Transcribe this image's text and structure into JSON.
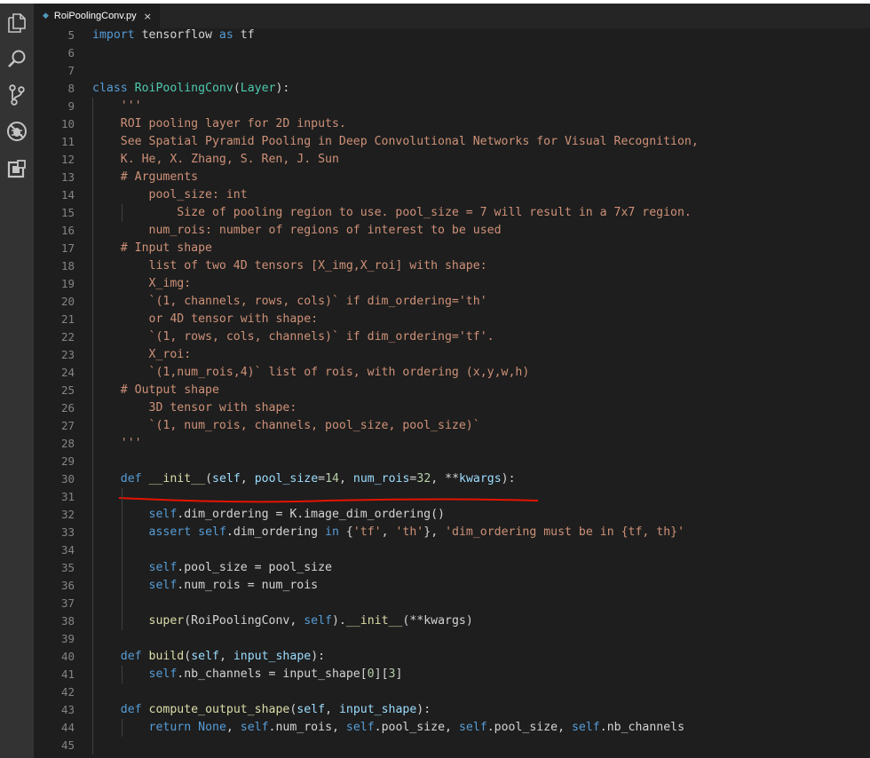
{
  "app": {
    "title": "RoiPoolingConv.py"
  },
  "activity_bar": {
    "icons": [
      "explorer-icon",
      "search-icon",
      "source-control-icon",
      "debug-icon",
      "extensions-icon"
    ]
  },
  "tab": {
    "label": "RoiPoolingConv.py",
    "close": "×",
    "icon": "python-file-icon"
  },
  "colors": {
    "keyword": "#569cd6",
    "function": "#dcdcaa",
    "class": "#4ec9b0",
    "string": "#ce9178",
    "variable": "#9cdcfe",
    "number": "#b5cea8",
    "plain": "#d4d4d4",
    "annotation": "#e51400"
  },
  "lines": [
    {
      "n": "5",
      "t": [
        [
          "kw",
          "import"
        ],
        [
          "p",
          " tensorflow "
        ],
        [
          "kw",
          "as"
        ],
        [
          "p",
          " tf"
        ]
      ]
    },
    {
      "n": "6",
      "t": []
    },
    {
      "n": "7",
      "t": []
    },
    {
      "n": "8",
      "t": [
        [
          "kw",
          "class"
        ],
        [
          "p",
          " "
        ],
        [
          "cls",
          "RoiPoolingConv"
        ],
        [
          "p",
          "("
        ],
        [
          "cls",
          "Layer"
        ],
        [
          "p",
          "):"
        ]
      ]
    },
    {
      "n": "9",
      "t": [
        [
          "p",
          "    "
        ],
        [
          "str",
          "'''"
        ]
      ]
    },
    {
      "n": "10",
      "t": [
        [
          "p",
          "    "
        ],
        [
          "str",
          "ROI pooling layer for 2D inputs."
        ]
      ]
    },
    {
      "n": "11",
      "t": [
        [
          "p",
          "    "
        ],
        [
          "str",
          "See Spatial Pyramid Pooling in Deep Convolutional Networks for Visual Recognition,"
        ]
      ]
    },
    {
      "n": "12",
      "t": [
        [
          "p",
          "    "
        ],
        [
          "str",
          "K. He, X. Zhang, S. Ren, J. Sun"
        ]
      ]
    },
    {
      "n": "13",
      "t": [
        [
          "p",
          "    "
        ],
        [
          "str",
          "# Arguments"
        ]
      ]
    },
    {
      "n": "14",
      "t": [
        [
          "p",
          "        "
        ],
        [
          "str",
          "pool_size: int"
        ]
      ]
    },
    {
      "n": "15",
      "t": [
        [
          "p",
          "            "
        ],
        [
          "str",
          "Size of pooling region to use. pool_size = 7 will result in a 7x7 region."
        ]
      ]
    },
    {
      "n": "16",
      "t": [
        [
          "p",
          "        "
        ],
        [
          "str",
          "num_rois: number of regions of interest to be used"
        ]
      ]
    },
    {
      "n": "17",
      "t": [
        [
          "p",
          "    "
        ],
        [
          "str",
          "# Input shape"
        ]
      ]
    },
    {
      "n": "18",
      "t": [
        [
          "p",
          "        "
        ],
        [
          "str",
          "list of two 4D tensors [X_img,X_roi] with shape:"
        ]
      ]
    },
    {
      "n": "19",
      "t": [
        [
          "p",
          "        "
        ],
        [
          "str",
          "X_img:"
        ]
      ]
    },
    {
      "n": "20",
      "t": [
        [
          "p",
          "        "
        ],
        [
          "str",
          "`(1, channels, rows, cols)` if dim_ordering='th'"
        ]
      ]
    },
    {
      "n": "21",
      "t": [
        [
          "p",
          "        "
        ],
        [
          "str",
          "or 4D tensor with shape:"
        ]
      ]
    },
    {
      "n": "22",
      "t": [
        [
          "p",
          "        "
        ],
        [
          "str",
          "`(1, rows, cols, channels)` if dim_ordering='tf'."
        ]
      ]
    },
    {
      "n": "23",
      "t": [
        [
          "p",
          "        "
        ],
        [
          "str",
          "X_roi:"
        ]
      ]
    },
    {
      "n": "24",
      "t": [
        [
          "p",
          "        "
        ],
        [
          "str",
          "`(1,num_rois,4)` list of rois, with ordering (x,y,w,h)"
        ]
      ]
    },
    {
      "n": "25",
      "t": [
        [
          "p",
          "    "
        ],
        [
          "str",
          "# Output shape"
        ]
      ]
    },
    {
      "n": "26",
      "t": [
        [
          "p",
          "        "
        ],
        [
          "str",
          "3D tensor with shape:"
        ]
      ]
    },
    {
      "n": "27",
      "t": [
        [
          "p",
          "        "
        ],
        [
          "str",
          "`(1, num_rois, channels, pool_size, pool_size)`"
        ]
      ]
    },
    {
      "n": "28",
      "t": [
        [
          "p",
          "    "
        ],
        [
          "str",
          "'''"
        ]
      ]
    },
    {
      "n": "29",
      "t": []
    },
    {
      "n": "30",
      "t": [
        [
          "p",
          "    "
        ],
        [
          "kw",
          "def"
        ],
        [
          "p",
          " "
        ],
        [
          "fn",
          "__init__"
        ],
        [
          "p",
          "("
        ],
        [
          "var",
          "self"
        ],
        [
          "p",
          ", "
        ],
        [
          "var",
          "pool_size"
        ],
        [
          "p",
          "="
        ],
        [
          "num",
          "14"
        ],
        [
          "p",
          ", "
        ],
        [
          "var",
          "num_rois"
        ],
        [
          "p",
          "="
        ],
        [
          "num",
          "32"
        ],
        [
          "p",
          ", **"
        ],
        [
          "var",
          "kwargs"
        ],
        [
          "p",
          "):"
        ]
      ]
    },
    {
      "n": "31",
      "t": []
    },
    {
      "n": "32",
      "t": [
        [
          "p",
          "        "
        ],
        [
          "self",
          "self"
        ],
        [
          "p",
          ".dim_ordering = K.image_dim_ordering()"
        ]
      ]
    },
    {
      "n": "33",
      "t": [
        [
          "p",
          "        "
        ],
        [
          "kw",
          "assert"
        ],
        [
          "p",
          " "
        ],
        [
          "self",
          "self"
        ],
        [
          "p",
          ".dim_ordering "
        ],
        [
          "kw",
          "in"
        ],
        [
          "p",
          " {"
        ],
        [
          "str",
          "'tf'"
        ],
        [
          "p",
          ", "
        ],
        [
          "str",
          "'th'"
        ],
        [
          "p",
          "}, "
        ],
        [
          "str",
          "'dim_ordering must be in {tf, th}'"
        ]
      ]
    },
    {
      "n": "34",
      "t": []
    },
    {
      "n": "35",
      "t": [
        [
          "p",
          "        "
        ],
        [
          "self",
          "self"
        ],
        [
          "p",
          ".pool_size = pool_size"
        ]
      ]
    },
    {
      "n": "36",
      "t": [
        [
          "p",
          "        "
        ],
        [
          "self",
          "self"
        ],
        [
          "p",
          ".num_rois = num_rois"
        ]
      ]
    },
    {
      "n": "37",
      "t": []
    },
    {
      "n": "38",
      "t": [
        [
          "p",
          "        "
        ],
        [
          "fn",
          "super"
        ],
        [
          "p",
          "(RoiPoolingConv, "
        ],
        [
          "self",
          "self"
        ],
        [
          "p",
          ")."
        ],
        [
          "fn",
          "__init__"
        ],
        [
          "p",
          "(**kwargs)"
        ]
      ]
    },
    {
      "n": "39",
      "t": []
    },
    {
      "n": "40",
      "t": [
        [
          "p",
          "    "
        ],
        [
          "kw",
          "def"
        ],
        [
          "p",
          " "
        ],
        [
          "fn",
          "build"
        ],
        [
          "p",
          "("
        ],
        [
          "var",
          "self"
        ],
        [
          "p",
          ", "
        ],
        [
          "var",
          "input_shape"
        ],
        [
          "p",
          "):"
        ]
      ]
    },
    {
      "n": "41",
      "t": [
        [
          "p",
          "        "
        ],
        [
          "self",
          "self"
        ],
        [
          "p",
          ".nb_channels = input_shape["
        ],
        [
          "num",
          "0"
        ],
        [
          "p",
          "]["
        ],
        [
          "num",
          "3"
        ],
        [
          "p",
          "]"
        ]
      ]
    },
    {
      "n": "42",
      "t": []
    },
    {
      "n": "43",
      "t": [
        [
          "p",
          "    "
        ],
        [
          "kw",
          "def"
        ],
        [
          "p",
          " "
        ],
        [
          "fn",
          "compute_output_shape"
        ],
        [
          "p",
          "("
        ],
        [
          "var",
          "self"
        ],
        [
          "p",
          ", "
        ],
        [
          "var",
          "input_shape"
        ],
        [
          "p",
          "):"
        ]
      ]
    },
    {
      "n": "44",
      "t": [
        [
          "p",
          "        "
        ],
        [
          "kw",
          "return"
        ],
        [
          "p",
          " "
        ],
        [
          "kw",
          "None"
        ],
        [
          "p",
          ", "
        ],
        [
          "self",
          "self"
        ],
        [
          "p",
          ".num_rois, "
        ],
        [
          "self",
          "self"
        ],
        [
          "p",
          ".pool_size, "
        ],
        [
          "self",
          "self"
        ],
        [
          "p",
          ".pool_size, "
        ],
        [
          "self",
          "self"
        ],
        [
          "p",
          ".nb_channels"
        ]
      ]
    },
    {
      "n": "45",
      "t": []
    }
  ],
  "guides": {
    "10": 1,
    "11": 1,
    "12": 1,
    "13": 1,
    "14": 1,
    "15": 2,
    "16": 1,
    "17": 1,
    "18": 1,
    "19": 1,
    "20": 1,
    "21": 1,
    "22": 1,
    "23": 1,
    "24": 1,
    "25": 1,
    "26": 1,
    "27": 1,
    "28": 1,
    "29": 1,
    "30": 1,
    "31": 2,
    "32": 2,
    "33": 2,
    "34": 2,
    "35": 2,
    "36": 2,
    "37": 2,
    "38": 2,
    "39": 1,
    "40": 1,
    "41": 2,
    "42": 1,
    "43": 1,
    "44": 2,
    "45": 1,
    "9": 1,
    "6": 0,
    "7": 0
  }
}
